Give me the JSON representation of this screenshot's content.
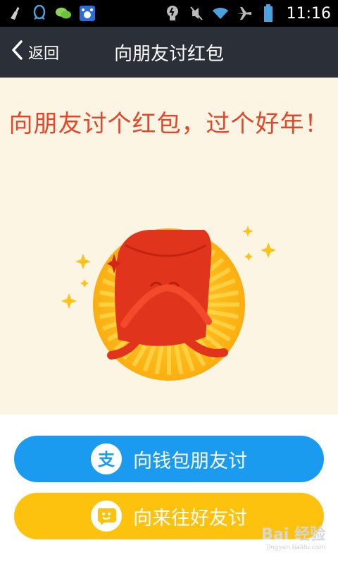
{
  "status_bar": {
    "time": "11:16",
    "left_icons": [
      "broom-icon",
      "qq-icon",
      "wechat-icon",
      "baidu-icon"
    ],
    "right_icons": [
      "bulb-icon",
      "mute-icon",
      "wifi-icon",
      "airplane-icon",
      "battery-icon"
    ]
  },
  "nav": {
    "back_label": "返回",
    "title": "向朋友讨红包"
  },
  "main": {
    "headline": "向朋友讨个红包，过个好年！"
  },
  "buttons": {
    "wallet_label": "向钱包朋友讨",
    "laiwang_label": "向来往好友讨"
  },
  "watermark": {
    "text": "Bai 经验",
    "sub": "jingyan.baidu.com"
  },
  "colors": {
    "nav": "#2b3038",
    "headline": "#e5462a",
    "blue": "#1a9bf0",
    "yellow": "#fdc20e",
    "sun": "#fdb716",
    "envelope": "#e0341c"
  }
}
